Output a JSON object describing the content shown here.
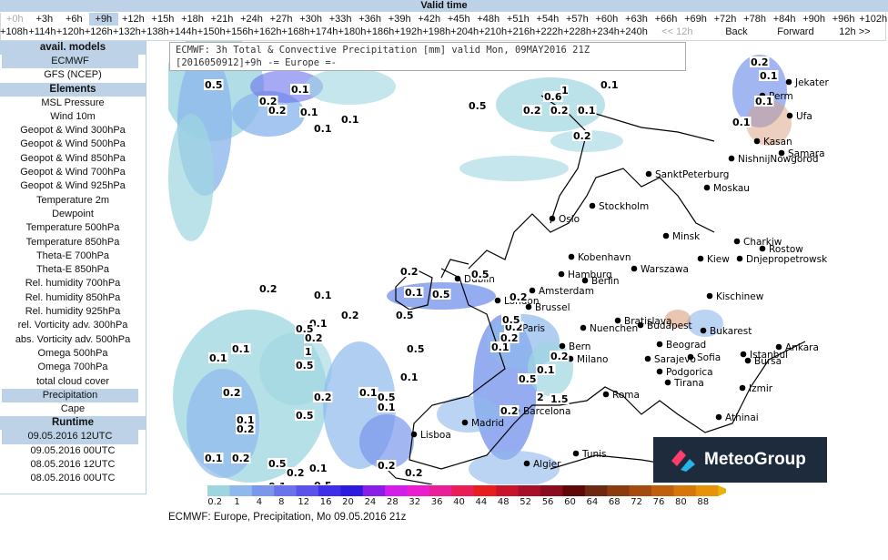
{
  "header": {
    "title": "Valid time"
  },
  "times_row1": [
    "+0h",
    "+3h",
    "+6h",
    "+9h",
    "+12h",
    "+15h",
    "+18h",
    "+21h",
    "+24h",
    "+27h",
    "+30h",
    "+33h",
    "+36h",
    "+39h",
    "+42h",
    "+45h",
    "+48h",
    "+51h",
    "+54h",
    "+57h",
    "+60h",
    "+63h",
    "+66h",
    "+69h",
    "+72h",
    "+78h",
    "+84h",
    "+90h",
    "+96h",
    "+102h"
  ],
  "times_row2": [
    "+108h",
    "+114h",
    "+120h",
    "+126h",
    "+132h",
    "+138h",
    "+144h",
    "+150h",
    "+156h",
    "+162h",
    "+168h",
    "+174h",
    "+180h",
    "+186h",
    "+192h",
    "+198h",
    "+204h",
    "+210h",
    "+216h",
    "+222h",
    "+228h",
    "+234h",
    "+240h",
    "<< 12h",
    "Back",
    "Forward",
    "12h >>"
  ],
  "selected_time": "+9h",
  "disabled_items": [
    "+0h",
    "<< 12h"
  ],
  "sidebar": {
    "models_title": "avail. models",
    "models": [
      "ECMWF",
      "GFS (NCEP)"
    ],
    "selected_model": "ECMWF",
    "elements_title": "Elements",
    "elements": [
      "MSL Pressure",
      "Wind 10m",
      "Geopot & Wind 300hPa",
      "Geopot & Wind 500hPa",
      "Geopot & Wind 850hPa",
      "Geopot & Wind 700hPa",
      "Geopot & Wind 925hPa",
      "Temperature 2m",
      "Dewpoint",
      "Temperature 500hPa",
      "Temperature 850hPa",
      "Theta-E 700hPa",
      "Theta-E 850hPa",
      "Rel. humidity 700hPa",
      "Rel. humidity 850hPa",
      "Rel. humidity 925hPa",
      "rel. Vorticity adv. 300hPa",
      "abs. Vorticity adv. 500hPa",
      "Omega 500hPa",
      "Omega 700hPa",
      "total cloud cover",
      "Precipitation",
      "Cape"
    ],
    "selected_element": "Precipitation",
    "runtime_title": "Runtime",
    "runtimes": [
      "09.05.2016 12UTC",
      "09.05.2016 00UTC",
      "08.05.2016 12UTC",
      "08.05.2016 00UTC"
    ],
    "selected_runtime": "09.05.2016 12UTC"
  },
  "map": {
    "title_line1": "ECMWF: 3h Total & Convective Precipitation [mm] valid Mon, 09MAY2016 21Z",
    "title_line2": "[2016050912]+9h -= Europe =-",
    "cities": [
      "Jekater",
      "Perm",
      "Ufa",
      "Kasan",
      "NishnijNowgorod",
      "Samara",
      "SanktPeterburg",
      "Moskau",
      "Stockholm",
      "Oslo",
      "Minsk",
      "Charkiw",
      "Rostow",
      "Kiew",
      "Dnjepropetrowsk",
      "Kobenhavn",
      "Warszawa",
      "Hamburg",
      "Berlin",
      "Dublin",
      "London",
      "Amsterdam",
      "Brussel",
      "Paris",
      "Bern",
      "Milano",
      "Nuenchen",
      "Bratislava",
      "Budapest",
      "Kischinew",
      "Bukarest",
      "Beograd",
      "Sarajevo",
      "Podgorica",
      "Tirana",
      "Sofia",
      "Istanbul",
      "Ankara",
      "Bursa",
      "Izmir",
      "Athinai",
      "Roma",
      "Barcelona",
      "Madrid",
      "Lisboa",
      "Algier",
      "Tunis"
    ],
    "values": [
      "0.5",
      "0.2",
      "0.1",
      "0.2",
      "0.1",
      "0.1",
      "0.1",
      "0.5",
      "0.2",
      "0.2",
      "0.1",
      "0.2",
      "1",
      "0.6",
      "0.1",
      "0.2",
      "0.1",
      "0.1",
      "0.1",
      "0.5",
      "0.2",
      "0.1",
      "0.5",
      "0.5",
      "0.2",
      "0.1",
      "0.2",
      "0.1",
      "0.5",
      "0.2",
      "0.5",
      "1",
      "0.2",
      "0.5",
      "0.2",
      "2",
      "1.5",
      "0.1",
      "0.1",
      "0.2",
      "0.1",
      "0.2",
      "0.5",
      "0.1",
      "0.5",
      "0.1",
      "0.1",
      "0.5",
      "0.2",
      "0.1",
      "0.2",
      "0.2",
      "0.5",
      "0.1",
      "0.2",
      "0.1",
      "0.2",
      "0.5",
      "0.1",
      "0.2",
      "0.1",
      "0.5",
      "0.2",
      "0.2"
    ],
    "logo_text": "MeteoGroup"
  },
  "legend": {
    "labels": [
      "0.2",
      "1",
      "4",
      "8",
      "12",
      "16",
      "20",
      "24",
      "28",
      "32",
      "36",
      "40",
      "44",
      "48",
      "52",
      "56",
      "60",
      "64",
      "68",
      "72",
      "76",
      "80",
      "88"
    ],
    "colors": [
      "#9ed6e0",
      "#8fb8ec",
      "#7b97ec",
      "#6a72ec",
      "#5a52ea",
      "#3f2fe8",
      "#2d1ae0",
      "#8a1ee8",
      "#d21ee8",
      "#ea1ecf",
      "#ea1e9a",
      "#e81e55",
      "#e81e1e",
      "#c8142a",
      "#a8102a",
      "#8a0c20",
      "#5e0808",
      "#6e2a10",
      "#8a3c10",
      "#a44c10",
      "#c0600e",
      "#d8760c",
      "#e8920a",
      "#e8b20a"
    ],
    "caption": "ECMWF: Europe, Precipitation, Mo 09.05.2016 21z"
  }
}
